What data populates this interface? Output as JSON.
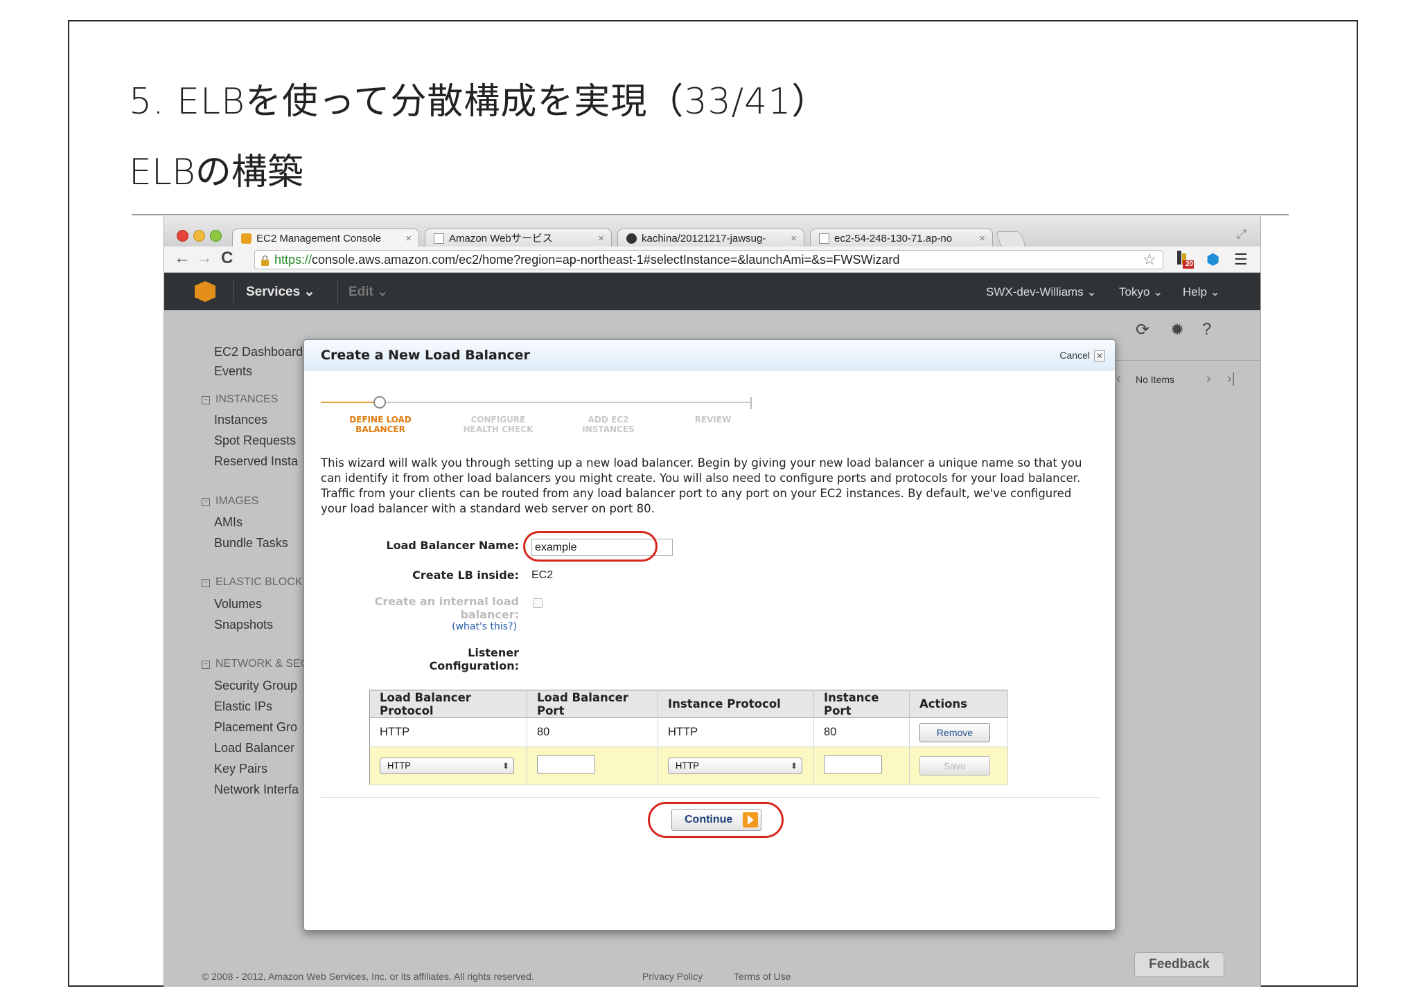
{
  "slide": {
    "title": "5. ELBを使って分散構成を実現（33/41）",
    "subtitle": "ELBの構築"
  },
  "browser": {
    "tabs": [
      {
        "label": "EC2 Management Console",
        "close": "×"
      },
      {
        "label": "Amazon Webサービス",
        "close": "×"
      },
      {
        "label": "kachina/20121217-jawsug-",
        "close": "×"
      },
      {
        "label": "ec2-54-248-130-71.ap-no",
        "close": "×"
      }
    ],
    "url_scheme": "https://",
    "url_rest": "console.aws.amazon.com/ec2/home?region=ap-northeast-1#selectInstance=&launchAmi=&s=FWSWizard",
    "badge_count": "20"
  },
  "aws_nav": {
    "services": "Services ⌄",
    "edit": "Edit ⌄",
    "account": "SWX-dev-Williams ⌄",
    "region": "Tokyo ⌄",
    "help": "Help ⌄"
  },
  "sidebar": {
    "dashboard": "EC2 Dashboard",
    "events": "Events",
    "instances_header": "INSTANCES",
    "instances": "Instances",
    "spot_requests": "Spot Requests",
    "reserved": "Reserved Insta",
    "images_header": "IMAGES",
    "amis": "AMIs",
    "bundle_tasks": "Bundle Tasks",
    "ebs_header": "ELASTIC BLOCK",
    "volumes": "Volumes",
    "snapshots": "Snapshots",
    "network_header": "NETWORK & SEC",
    "security_groups": "Security Group",
    "elastic_ips": "Elastic IPs",
    "placement_groups": "Placement Gro",
    "load_balancers": "Load Balancer",
    "key_pairs": "Key Pairs",
    "network_interfaces": "Network Interfa"
  },
  "right_panel": {
    "pager_text": "No Items"
  },
  "footer": {
    "copyright": "© 2008 - 2012, Amazon Web Services, Inc. or its affiliates. All rights reserved.",
    "privacy": "Privacy Policy",
    "terms": "Terms of Use",
    "feedback": "Feedback"
  },
  "modal": {
    "title": "Create a New Load Balancer",
    "cancel": "Cancel",
    "steps": [
      {
        "line1": "DEFINE LOAD",
        "line2": "BALANCER",
        "active": true
      },
      {
        "line1": "CONFIGURE",
        "line2": "HEALTH CHECK",
        "active": false
      },
      {
        "line1": "ADD EC2",
        "line2": "INSTANCES",
        "active": false
      },
      {
        "line1": "REVIEW",
        "line2": "",
        "active": false
      }
    ],
    "intro": "This wizard will walk you through setting up a new load balancer. Begin by giving your new load balancer a unique name so that you can identify it from other load balancers you might create. You will also need to configure ports and protocols for your load balancer. Traffic from your clients can be routed from any load balancer port to any port on your EC2 instances. By default, we've configured your load balancer with a standard web server on port 80.",
    "name_label": "Load Balancer Name:",
    "name_value": "example",
    "inside_label": "Create LB inside:",
    "inside_value": "EC2",
    "internal_label_1": "Create an internal load",
    "internal_label_2": "balancer:",
    "whats_this": "(what's this?)",
    "listener_label_1": "Listener",
    "listener_label_2": "Configuration:",
    "table": {
      "headers": [
        "Load Balancer Protocol",
        "Load Balancer Port",
        "Instance Protocol",
        "Instance Port",
        "Actions"
      ],
      "row": {
        "lb_protocol": "HTTP",
        "lb_port": "80",
        "inst_protocol": "HTTP",
        "inst_port": "80",
        "action": "Remove"
      },
      "edit_row": {
        "lb_protocol": "HTTP",
        "inst_protocol": "HTTP",
        "action": "Save"
      }
    },
    "continue": "Continue"
  }
}
